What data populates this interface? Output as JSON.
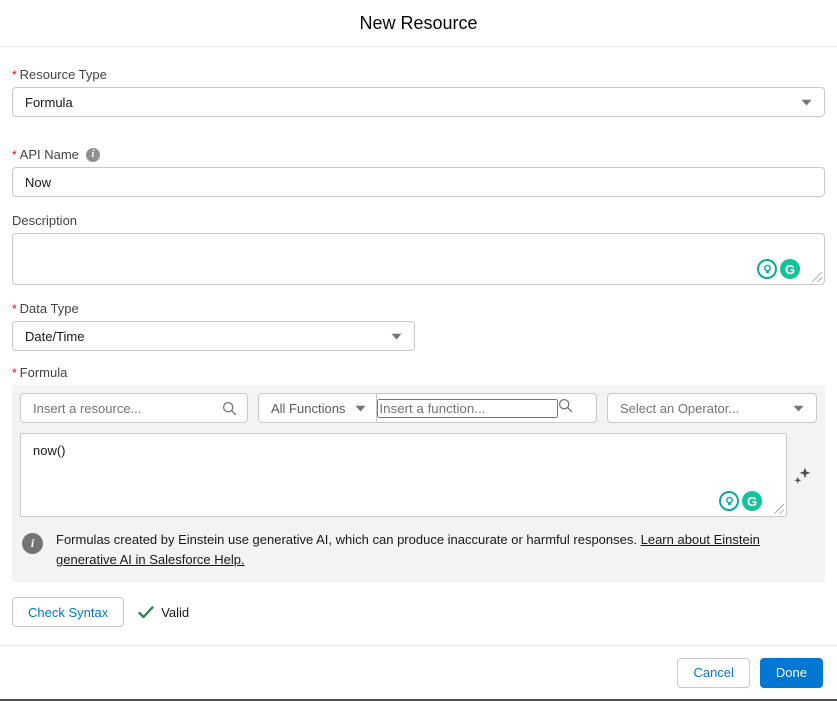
{
  "ui": {
    "required_marker": "*"
  },
  "modal": {
    "title": "New Resource"
  },
  "fields": {
    "resource_type": {
      "label": "Resource Type",
      "value": "Formula"
    },
    "api_name": {
      "label": "API Name",
      "value": "Now"
    },
    "description": {
      "label": "Description",
      "value": ""
    },
    "data_type": {
      "label": "Data Type",
      "value": "Date/Time"
    },
    "formula": {
      "label": "Formula",
      "value": "now()"
    }
  },
  "formula_builder": {
    "resource_search_placeholder": "Insert a resource...",
    "function_filter_value": "All Functions",
    "function_search_placeholder": "Insert a function...",
    "operator_value": "Select an Operator...",
    "disclaimer_text": "Formulas created by Einstein use generative AI, which can produce inaccurate or harmful responses.",
    "disclaimer_link": "Learn about Einstein generative AI in Salesforce Help."
  },
  "icons": {
    "info_glyph": "i",
    "grammarly_letter": "G"
  },
  "syntax": {
    "check_button_label": "Check Syntax",
    "valid_label": "Valid"
  },
  "footer": {
    "cancel_label": "Cancel",
    "done_label": "Done"
  },
  "colors": {
    "accent_blue": "#0176d3",
    "required_red": "#ea001e",
    "valid_green": "#2e844a",
    "grammarly_green": "#15c39a",
    "einstein_teal": "#0aa89e",
    "panel_gray": "#f3f3f3"
  }
}
